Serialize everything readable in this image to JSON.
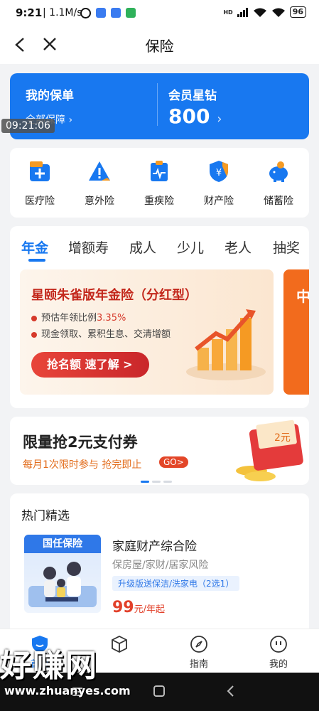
{
  "status": {
    "time": "9:21",
    "speed": "1.1M/s",
    "battery": "96",
    "net": "HD"
  },
  "nav": {
    "title": "保险"
  },
  "policy": {
    "my_policy": "我的保单",
    "all_coverage": "全部保障",
    "member": "会员星钻",
    "points": "800"
  },
  "timestamp": "09:21:06",
  "categories": [
    {
      "label": "医疗险",
      "icon": "medical-icon"
    },
    {
      "label": "意外险",
      "icon": "accident-icon"
    },
    {
      "label": "重疾险",
      "icon": "critical-illness-icon"
    },
    {
      "label": "财产险",
      "icon": "property-icon"
    },
    {
      "label": "储蓄险",
      "icon": "savings-icon"
    }
  ],
  "tabs": [
    "年金",
    "增额寿",
    "成人",
    "少儿",
    "老人",
    "抽奖"
  ],
  "banner": {
    "title": "星颐朱雀版年金险（分红型）",
    "bullet1_prefix": "预估年领比例",
    "bullet1_value": "3.35%",
    "bullet2": "现金领取、累积生息、交清增额",
    "button": "抢名额 速了解 >",
    "peek": "中"
  },
  "coupon": {
    "title": "限量抢2元支付券",
    "subtitle": "每月1次限时参与 抢完即止",
    "go": "GO>"
  },
  "hot": {
    "title": "热门精选",
    "product": {
      "brand": "国任保险",
      "name": "家庭财产综合险",
      "desc": "保房屋/家财/居家风险",
      "tag": "升级版送保洁/洗家电（2选1）",
      "price": "99",
      "unit": "元/年起"
    }
  },
  "bottom_nav": [
    {
      "label": "首页",
      "icon": "home-shield-icon"
    },
    {
      "label": "",
      "icon": "cube-icon"
    },
    {
      "label": "指南",
      "icon": "compass-icon"
    },
    {
      "label": "我的",
      "icon": "profile-icon"
    }
  ],
  "watermark": {
    "text": "好赚网",
    "url": "www.zhuanyes.com"
  },
  "colors": {
    "primary": "#1878f0",
    "accent": "#e2402a"
  }
}
